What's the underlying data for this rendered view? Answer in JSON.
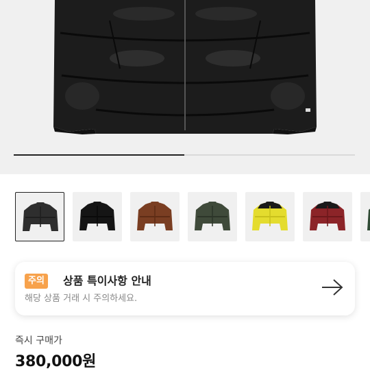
{
  "product_gallery": {
    "progress": 0.5,
    "thumbnails": [
      {
        "color_name": "black",
        "selected": true,
        "body": "#2e2e2e",
        "shade": "#1f1f1f",
        "yoke": "#2e2e2e"
      },
      {
        "color_name": "black",
        "selected": false,
        "body": "#151515",
        "shade": "#0a0a0a",
        "yoke": "#151515"
      },
      {
        "color_name": "brown",
        "selected": false,
        "body": "#7a3e22",
        "shade": "#5e2c15",
        "yoke": "#7a3e22"
      },
      {
        "color_name": "green",
        "selected": false,
        "body": "#3f4a3a",
        "shade": "#2c3529",
        "yoke": "#3f4a3a"
      },
      {
        "color_name": "yellow",
        "selected": false,
        "body": "#e4dc2e",
        "shade": "#c9c11c",
        "yoke": "#1a1a1a"
      },
      {
        "color_name": "red",
        "selected": false,
        "body": "#8c2428",
        "shade": "#6d181b",
        "yoke": "#1a1a1a"
      },
      {
        "color_name": "green",
        "selected": false,
        "body": "#2f4a34",
        "shade": "#213826",
        "yoke": "#2f4a34"
      }
    ]
  },
  "notice": {
    "badge": "주의",
    "title": "상품 특이사항 안내",
    "description": "해당 상품 거래 시 주의하세요.",
    "arrow_icon": "arrow-right-icon"
  },
  "price": {
    "label": "즉시 구매가",
    "value": "380,000원"
  }
}
